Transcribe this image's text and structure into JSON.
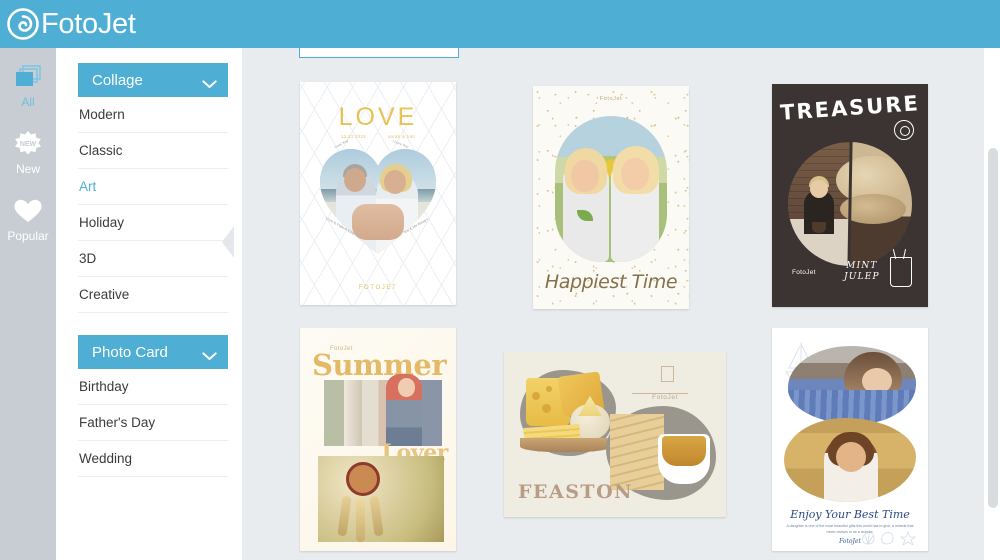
{
  "header": {
    "brand": "FotoJet",
    "logo_icon": "fotojet-spiral-logo",
    "bg_color": "#4eaed3"
  },
  "rail": {
    "items": [
      {
        "label": "All",
        "icon": "layers-stack-icon",
        "active": true
      },
      {
        "label": "New",
        "icon": "new-starburst-icon",
        "active": false
      },
      {
        "label": "Popular",
        "icon": "heart-icon",
        "active": false
      }
    ]
  },
  "categories": [
    {
      "title": "Collage",
      "expanded": true,
      "chevron_icon": "chevron-down-icon",
      "items": [
        {
          "label": "Modern",
          "selected": false
        },
        {
          "label": "Classic",
          "selected": false
        },
        {
          "label": "Art",
          "selected": true
        },
        {
          "label": "Holiday",
          "selected": false
        },
        {
          "label": "3D",
          "selected": false
        },
        {
          "label": "Creative",
          "selected": false
        }
      ]
    },
    {
      "title": "Photo Card",
      "expanded": true,
      "chevron_icon": "chevron-down-icon",
      "items": [
        {
          "label": "Birthday",
          "selected": false
        },
        {
          "label": "Father's Day",
          "selected": false
        },
        {
          "label": "Wedding",
          "selected": false
        }
      ]
    }
  ],
  "templates": {
    "love": {
      "title": "LOVE",
      "date": "12.23.2015",
      "names": "sarah & tom",
      "footer": "FOTOJET",
      "heart_labels": [
        "Love You",
        "I Love You",
        "Love Is Patient Kind",
        "You & Me Always"
      ]
    },
    "happy": {
      "watermark": "FotoJet",
      "title": "Happiest Time"
    },
    "treasure": {
      "title": "TREASURE",
      "watermark": "FotoJet",
      "caption_line1": "MINT",
      "caption_line2": "JULEP",
      "sun_icon": "sun-doodle-icon",
      "glass_icon": "cocktail-glass-doodle-icon"
    },
    "summer": {
      "watermark": "FotoJet",
      "title": "Summer",
      "subtitle": "Lover"
    },
    "feast": {
      "title": "FEASTON",
      "watermark": "FotoJet",
      "doodle_icon": "breakfast-sketch-icon"
    },
    "enjoy": {
      "title": "Enjoy Your Best Time",
      "body": "A daughter is one of the most beautiful gifts this world has to give, a miracle that never ceases to be a wonder.",
      "signature": "FotoJet",
      "boat_icon": "sailboat-sketch-icon",
      "shells_icon": "seashells-sketch-icon"
    }
  },
  "scrollbar": {
    "orientation": "vertical"
  }
}
